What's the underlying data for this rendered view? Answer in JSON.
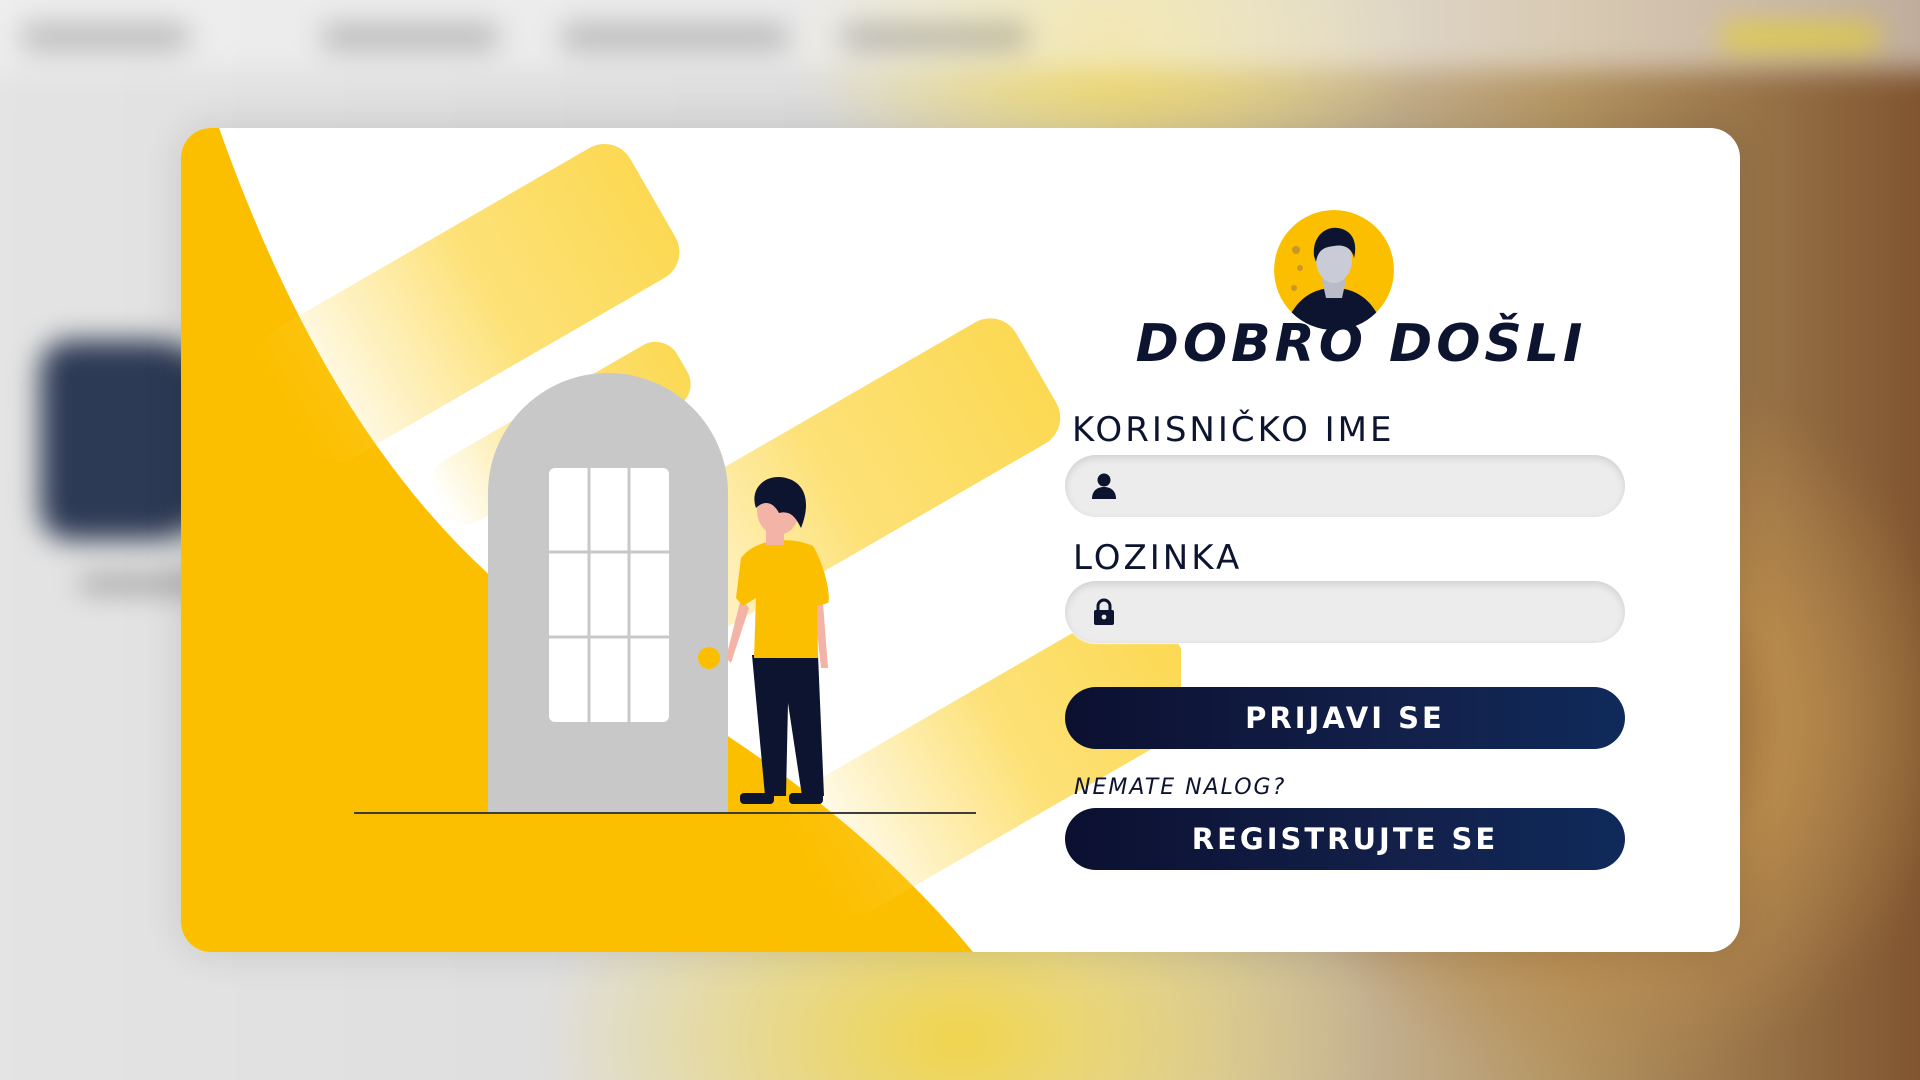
{
  "theme": {
    "accent": "#fcbf00",
    "navy": "#0c1430",
    "field_bg": "#ececec",
    "door_gray": "#c8c8c8"
  },
  "login": {
    "title": "DOBRO DOŠLI",
    "username": {
      "label": "KORISNIČKO IME",
      "value": "",
      "icon": "user-icon"
    },
    "password": {
      "label": "LOZINKA",
      "value": "",
      "icon": "lock-icon"
    },
    "submit_label": "PRIJAVI SE",
    "no_account_text": "NEMATE NALOG?",
    "register_label": "REGISTRUJTE SE"
  }
}
